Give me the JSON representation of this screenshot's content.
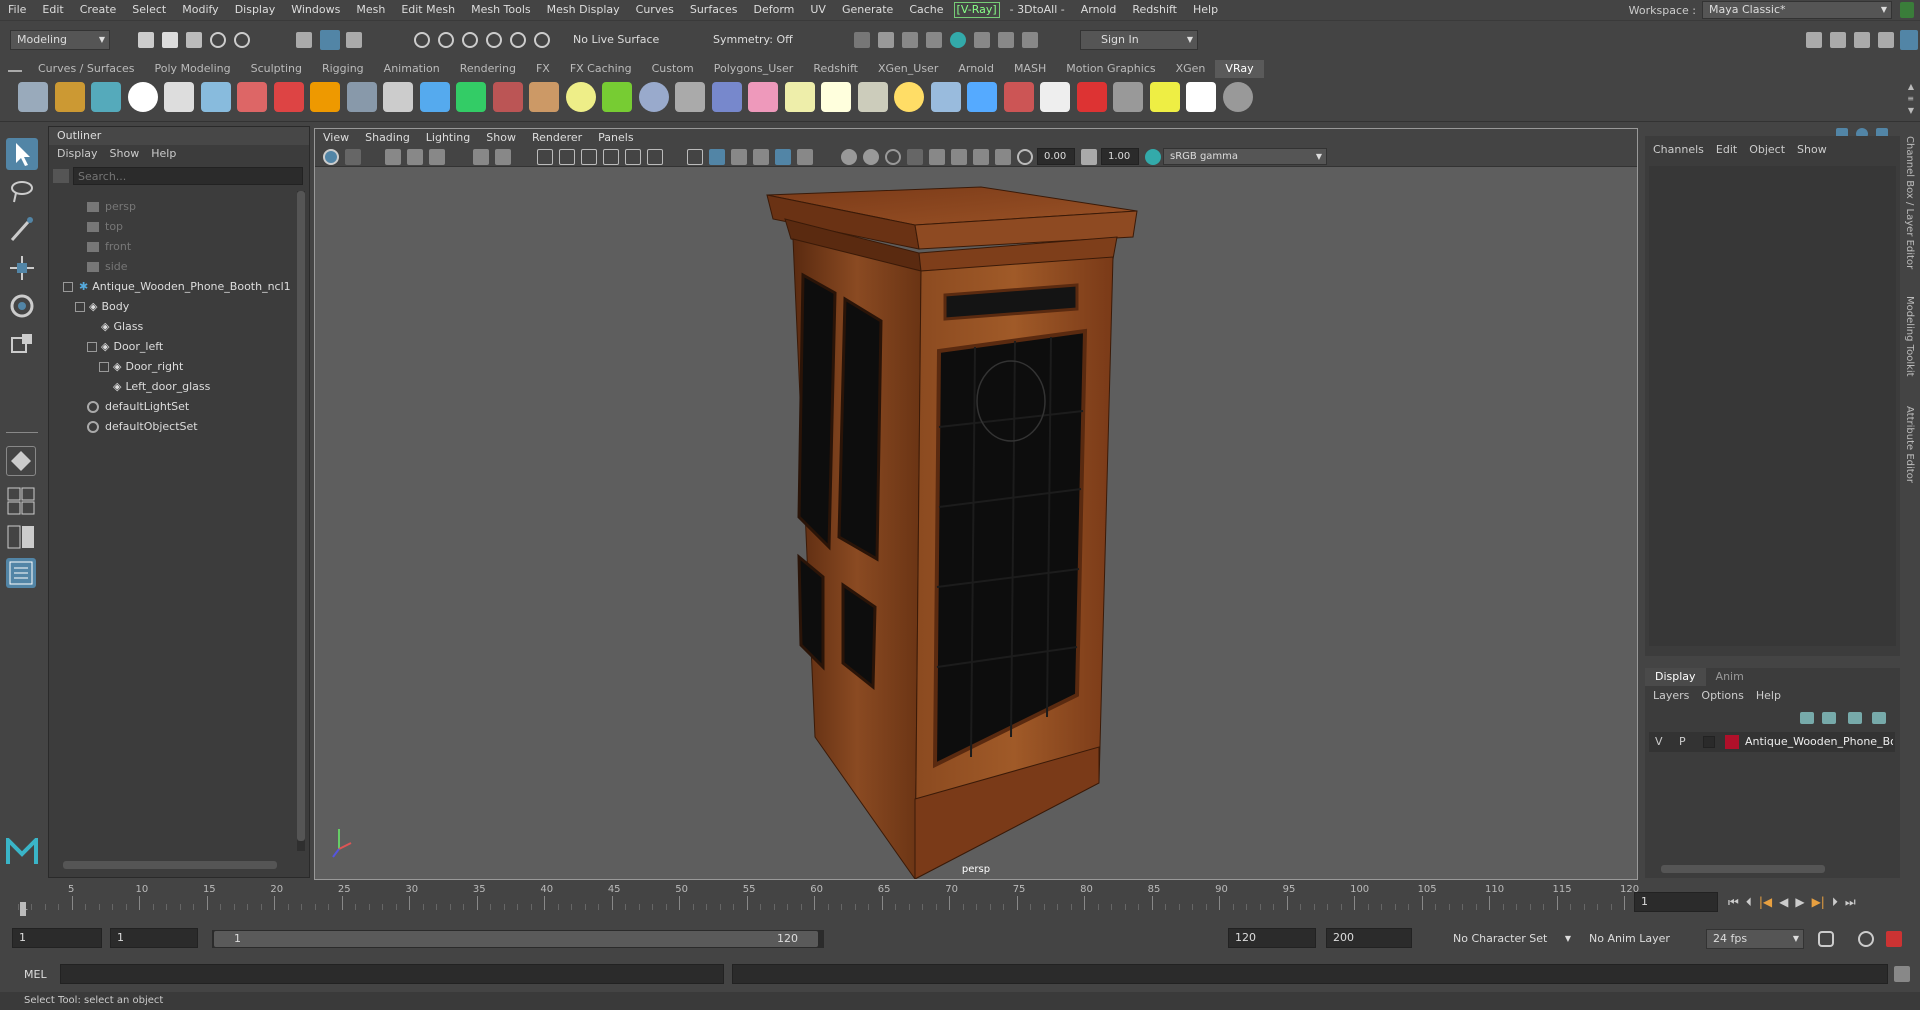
{
  "menubar": {
    "items": [
      "File",
      "Edit",
      "Create",
      "Select",
      "Modify",
      "Display",
      "Windows",
      "Mesh",
      "Edit Mesh",
      "Mesh Tools",
      "Mesh Display",
      "Curves",
      "Surfaces",
      "Deform",
      "UV",
      "Generate",
      "Cache"
    ],
    "vray": "[V-Ray]",
    "items2": [
      "- 3DtoAll -",
      "Arnold",
      "Redshift",
      "Help"
    ],
    "workspace_label": "Workspace :",
    "workspace_value": "Maya Classic*"
  },
  "statusline": {
    "mode": "Modeling",
    "live_surface": "No Live Surface",
    "symmetry": "Symmetry: Off",
    "sign_in": "Sign In"
  },
  "shelf": {
    "tabs": [
      "Curves / Surfaces",
      "Poly Modeling",
      "Sculpting",
      "Rigging",
      "Animation",
      "Rendering",
      "FX",
      "FX Caching",
      "Custom",
      "Polygons_User",
      "Redshift",
      "XGen_User",
      "Arnold",
      "MASH",
      "Motion Graphics",
      "XGen",
      "VRay"
    ],
    "active": "VRay"
  },
  "outliner": {
    "title": "Outliner",
    "menu": [
      "Display",
      "Show",
      "Help"
    ],
    "search_placeholder": "Search...",
    "items": [
      {
        "label": "persp",
        "dim": true
      },
      {
        "label": "top",
        "dim": true
      },
      {
        "label": "front",
        "dim": true
      },
      {
        "label": "side",
        "dim": true
      },
      {
        "label": "Antique_Wooden_Phone_Booth_ncl1",
        "dim": false
      },
      {
        "label": "Body",
        "dim": false
      },
      {
        "label": "Glass",
        "dim": false
      },
      {
        "label": "Door_left",
        "dim": false
      },
      {
        "label": "Door_right",
        "dim": false
      },
      {
        "label": "Left_door_glass",
        "dim": false
      },
      {
        "label": "defaultLightSet",
        "dim": false
      },
      {
        "label": "defaultObjectSet",
        "dim": false
      }
    ]
  },
  "viewport": {
    "menu": [
      "View",
      "Shading",
      "Lighting",
      "Show",
      "Renderer",
      "Panels"
    ],
    "exposure": "0.00",
    "gamma": "1.00",
    "color_space": "sRGB gamma",
    "camera": "persp"
  },
  "channelbox": {
    "menu": [
      "Channels",
      "Edit",
      "Object",
      "Show"
    ]
  },
  "layer_editor": {
    "tabs": [
      "Display",
      "Anim"
    ],
    "menu": [
      "Layers",
      "Options",
      "Help"
    ],
    "layer": {
      "v": "V",
      "p": "P",
      "name": "Antique_Wooden_Phone_Booth",
      "color": "#b0102a"
    }
  },
  "side_tabs": [
    "Channel Box / Layer Editor",
    "Modeling Toolkit",
    "Attribute Editor"
  ],
  "timeline": {
    "ticks": [
      "5",
      "10",
      "15",
      "20",
      "25",
      "30",
      "35",
      "40",
      "45",
      "50",
      "55",
      "60",
      "65",
      "70",
      "75",
      "80",
      "85",
      "90",
      "95",
      "100",
      "105",
      "110",
      "115",
      "120"
    ],
    "start_tick": "1",
    "current_frame": "1"
  },
  "range": {
    "start": "1",
    "playback_start": "1",
    "slider_start": "1",
    "slider_end": "120",
    "playback_end": "120",
    "end": "200",
    "character_set": "No Character Set",
    "anim_layer": "No Anim Layer",
    "fps": "24 fps"
  },
  "cmd": {
    "label": "MEL"
  },
  "help": {
    "text": "Select Tool: select an object"
  },
  "colors": {
    "accent": "#5285a6",
    "wood": "#7a3d1a",
    "glass": "#0d0d0d"
  }
}
